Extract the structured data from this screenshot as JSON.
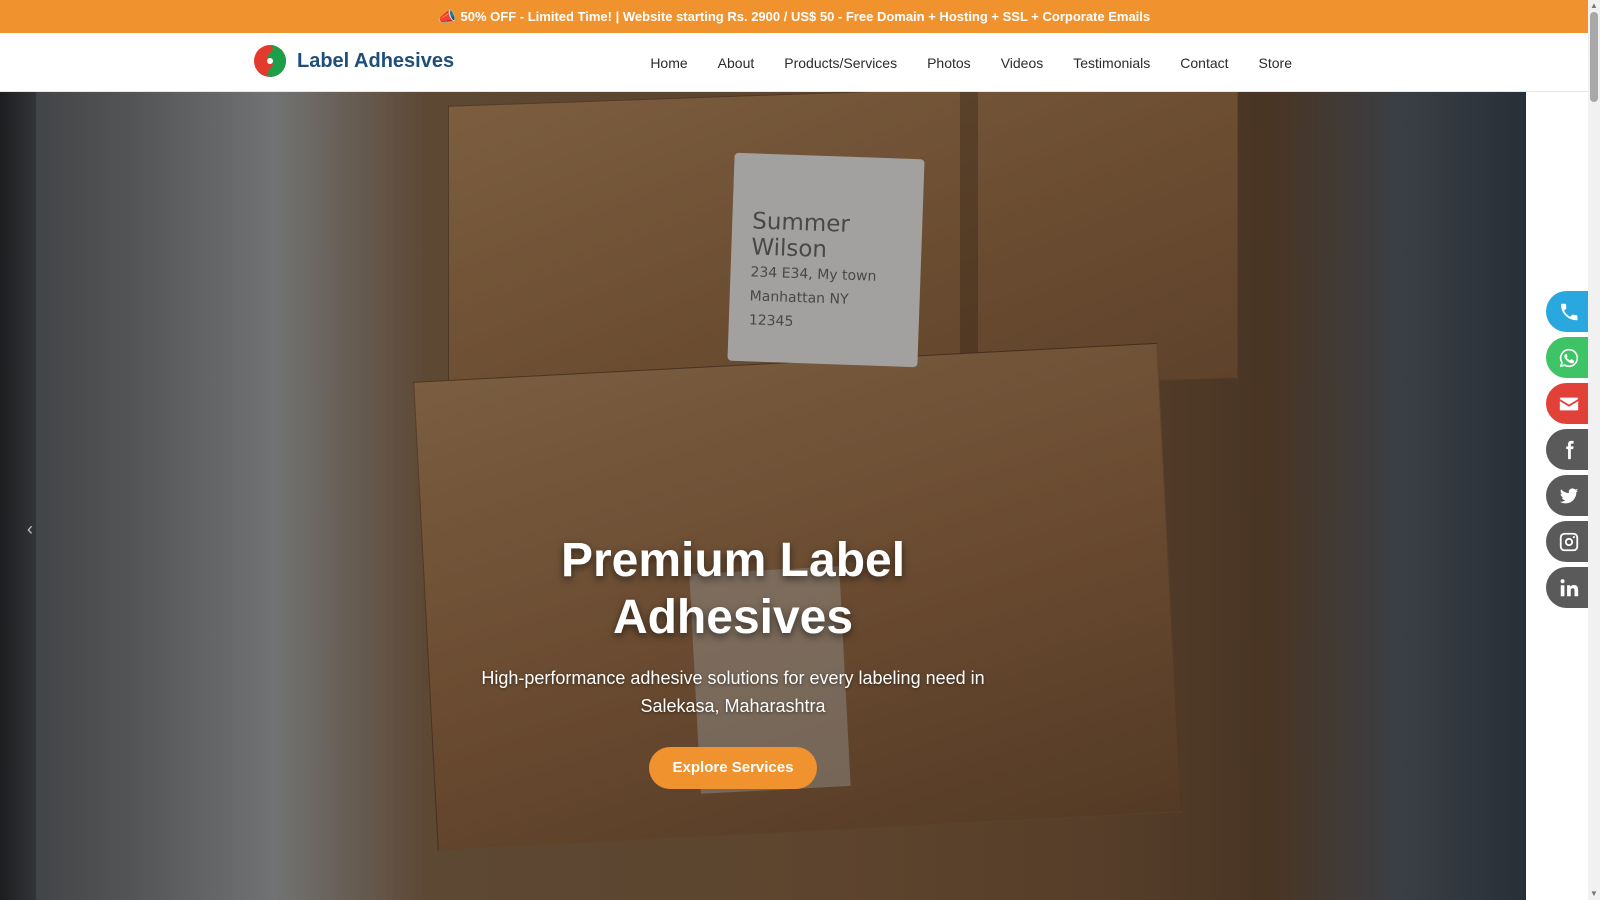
{
  "promo": {
    "icon": "megaphone-icon",
    "text": "50% OFF - Limited Time! | Website starting Rs. 2900 / US$ 50 - Free Domain + Hosting + SSL + Corporate Emails"
  },
  "brand": {
    "name": "Label Adhesives",
    "logo_colors": [
      "#e23b2e",
      "#1f9e4a"
    ],
    "title_color": "#1f4e79"
  },
  "nav": {
    "items": [
      "Home",
      "About",
      "Products/Services",
      "Photos",
      "Videos",
      "Testimonials",
      "Contact",
      "Store"
    ]
  },
  "hero": {
    "title": "Premium Label Adhesives",
    "subtitle": "High-performance adhesive solutions for every labeling need in Salekasa, Maharashtra",
    "cta": "Explore Services",
    "label_name": "Summer Wilson",
    "label_lines": [
      "234 E34, My town",
      "Manhattan NY",
      "12345"
    ],
    "accent": "#f0922e"
  },
  "floating": [
    {
      "icon": "phone-icon",
      "color": "#29a8e0"
    },
    {
      "icon": "whatsapp-icon",
      "color": "#3ec466"
    },
    {
      "icon": "mail-icon",
      "color": "#e2413a"
    },
    {
      "icon": "facebook-icon",
      "color": "#5a5a5a"
    },
    {
      "icon": "twitter-icon",
      "color": "#5a5a5a"
    },
    {
      "icon": "instagram-icon",
      "color": "#5a5a5a"
    },
    {
      "icon": "linkedin-icon",
      "color": "#5a5a5a"
    }
  ]
}
